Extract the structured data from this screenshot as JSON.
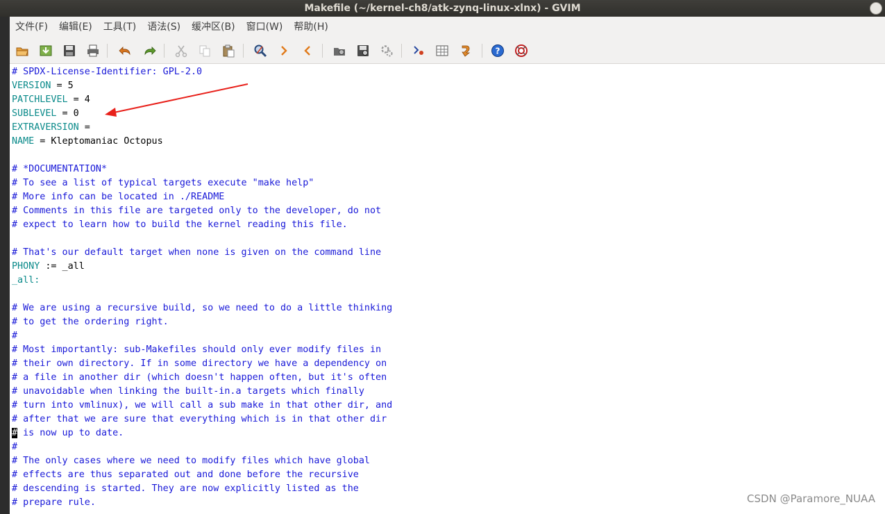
{
  "window": {
    "title": "Makefile (~/kernel-ch8/atk-zynq-linux-xlnx) - GVIM"
  },
  "menu": {
    "items": [
      "文件(F)",
      "编辑(E)",
      "工具(T)",
      "语法(S)",
      "缓冲区(B)",
      "窗口(W)",
      "帮助(H)"
    ]
  },
  "toolbar": {
    "icons": [
      "open-icon",
      "load-session-icon",
      "save-icon",
      "print-icon",
      "undo-icon",
      "redo-icon",
      "cut-icon",
      "copy-icon",
      "paste-icon",
      "find-replace-icon",
      "find-next-icon",
      "find-prev-icon",
      "load-script-icon",
      "save-session-icon",
      "run-script-icon",
      "make-icon",
      "ctags-icon",
      "jump-tag-icon",
      "help-icon",
      "find-help-icon"
    ]
  },
  "editor": {
    "lines": [
      {
        "segments": [
          {
            "t": "# SPDX-License-Identifier: GPL-2.0",
            "c": "cm"
          }
        ]
      },
      {
        "segments": [
          {
            "t": "VERSION",
            "c": "var"
          },
          {
            "t": " = 5",
            "c": "txt"
          }
        ]
      },
      {
        "segments": [
          {
            "t": "PATCHLEVEL",
            "c": "var"
          },
          {
            "t": " = 4",
            "c": "txt"
          }
        ]
      },
      {
        "segments": [
          {
            "t": "SUBLEVEL",
            "c": "var"
          },
          {
            "t": " = 0",
            "c": "txt"
          }
        ]
      },
      {
        "segments": [
          {
            "t": "EXTRAVERSION",
            "c": "var"
          },
          {
            "t": " =",
            "c": "txt"
          }
        ]
      },
      {
        "segments": [
          {
            "t": "NAME",
            "c": "var"
          },
          {
            "t": " = Kleptomaniac Octopus",
            "c": "txt"
          }
        ]
      },
      {
        "segments": []
      },
      {
        "segments": [
          {
            "t": "# *DOCUMENTATION*",
            "c": "cm"
          }
        ]
      },
      {
        "segments": [
          {
            "t": "# To see a list of typical targets execute \"make help\"",
            "c": "cm"
          }
        ]
      },
      {
        "segments": [
          {
            "t": "# More info can be located in ./README",
            "c": "cm"
          }
        ]
      },
      {
        "segments": [
          {
            "t": "# Comments in this file are targeted only to the developer, do not",
            "c": "cm"
          }
        ]
      },
      {
        "segments": [
          {
            "t": "# expect to learn how to build the kernel reading this file.",
            "c": "cm"
          }
        ]
      },
      {
        "segments": []
      },
      {
        "segments": [
          {
            "t": "# That's our default target when none is given on the command line",
            "c": "cm"
          }
        ]
      },
      {
        "segments": [
          {
            "t": "PHONY",
            "c": "var"
          },
          {
            "t": " := _all",
            "c": "txt"
          }
        ]
      },
      {
        "segments": [
          {
            "t": "_all:",
            "c": "tgt"
          }
        ]
      },
      {
        "segments": []
      },
      {
        "segments": [
          {
            "t": "# We are using a recursive build, so we need to do a little thinking",
            "c": "cm"
          }
        ]
      },
      {
        "segments": [
          {
            "t": "# to get the ordering right.",
            "c": "cm"
          }
        ]
      },
      {
        "segments": [
          {
            "t": "#",
            "c": "cm"
          }
        ]
      },
      {
        "segments": [
          {
            "t": "# Most importantly: sub-Makefiles should only ever modify files in",
            "c": "cm"
          }
        ]
      },
      {
        "segments": [
          {
            "t": "# their own directory. If in some directory we have a dependency on",
            "c": "cm"
          }
        ]
      },
      {
        "segments": [
          {
            "t": "# a file in another dir (which doesn't happen often, but it's often",
            "c": "cm"
          }
        ]
      },
      {
        "segments": [
          {
            "t": "# unavoidable when linking the built-in.a targets which finally",
            "c": "cm"
          }
        ]
      },
      {
        "segments": [
          {
            "t": "# turn into vmlinux), we will call a sub make in that other dir, and",
            "c": "cm"
          }
        ]
      },
      {
        "segments": [
          {
            "t": "# after that we are sure that everything which is in that other dir",
            "c": "cm"
          }
        ]
      },
      {
        "segments": [
          {
            "t": "#",
            "c": "cursor"
          },
          {
            "t": " is now up to date.",
            "c": "cm"
          }
        ]
      },
      {
        "segments": [
          {
            "t": "#",
            "c": "cm"
          }
        ]
      },
      {
        "segments": [
          {
            "t": "# The only cases where we need to modify files which have global",
            "c": "cm"
          }
        ]
      },
      {
        "segments": [
          {
            "t": "# effects are thus separated out and done before the recursive",
            "c": "cm"
          }
        ]
      },
      {
        "segments": [
          {
            "t": "# descending is started. They are now explicitly listed as the",
            "c": "cm"
          }
        ]
      },
      {
        "segments": [
          {
            "t": "# prepare rule.",
            "c": "cm"
          }
        ]
      }
    ]
  },
  "annotation": {
    "arrow_color": "#e8201a"
  },
  "watermark": "CSDN @Paramore_NUAA",
  "colors": {
    "comment": "#1818d8",
    "variable": "#0a8a8a",
    "text": "#000000"
  }
}
